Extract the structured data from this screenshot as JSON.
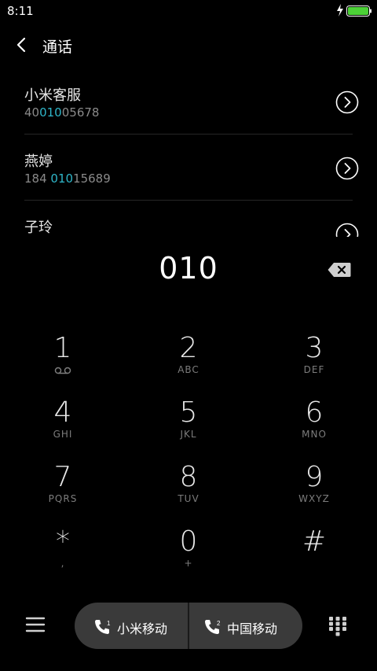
{
  "status": {
    "time": "8:11",
    "battery_color": "#4cd137"
  },
  "header": {
    "title": "通话"
  },
  "contacts": [
    {
      "name": "小米客服",
      "num_pre": "40",
      "num_hl": "010",
      "num_post": "05678"
    },
    {
      "name": "燕婷",
      "num_pre": "184 ",
      "num_hl": "010",
      "num_post": "15689"
    },
    {
      "name": "子玲"
    }
  ],
  "dialer": {
    "typed": "010"
  },
  "keypad": [
    {
      "digit": "1",
      "letters": ""
    },
    {
      "digit": "2",
      "letters": "ABC"
    },
    {
      "digit": "3",
      "letters": "DEF"
    },
    {
      "digit": "4",
      "letters": "GHI"
    },
    {
      "digit": "5",
      "letters": "JKL"
    },
    {
      "digit": "6",
      "letters": "MNO"
    },
    {
      "digit": "7",
      "letters": "PQRS"
    },
    {
      "digit": "8",
      "letters": "TUV"
    },
    {
      "digit": "9",
      "letters": "WXYZ"
    },
    {
      "digit": "*",
      "letters": ","
    },
    {
      "digit": "0",
      "letters": "+"
    },
    {
      "digit": "#",
      "letters": ""
    }
  ],
  "sim": [
    {
      "badge": "1",
      "label": "小米移动"
    },
    {
      "badge": "2",
      "label": "中国移动"
    }
  ],
  "colors": {
    "highlight": "#2fb6c9",
    "pill": "#3a3a3a"
  }
}
